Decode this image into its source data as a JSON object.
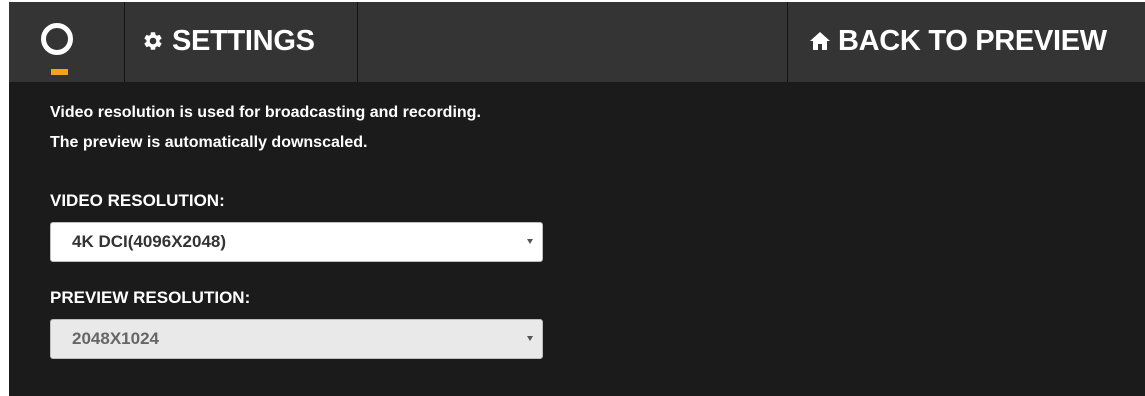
{
  "header": {
    "logo_icon": "ring-logo-icon",
    "settings_tab": {
      "icon": "gear-icon",
      "label": "SETTINGS"
    },
    "back_tab": {
      "icon": "home-icon",
      "label": "BACK TO PREVIEW"
    }
  },
  "main": {
    "description_lines": [
      "Video resolution is used for broadcasting and recording.",
      "The preview is automatically downscaled."
    ],
    "video_resolution": {
      "label": "VIDEO RESOLUTION:",
      "value": "4K DCI(4096X2048)"
    },
    "preview_resolution": {
      "label": "PREVIEW RESOLUTION:",
      "value": "2048X1024"
    }
  },
  "colors": {
    "background": "#1b1b1b",
    "topbar": "#343434",
    "accent": "#f5a31a",
    "text": "#ffffff"
  }
}
